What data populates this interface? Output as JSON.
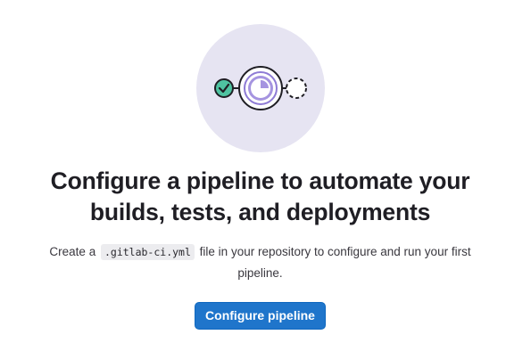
{
  "empty_state": {
    "illustration_icons": [
      "check-circle-icon",
      "pipeline-running-icon",
      "pending-dashed-circle-icon"
    ],
    "title_line1": "Configure a pipeline to automate your",
    "title_line2": "builds, tests, and deployments",
    "description_prefix": "Create a",
    "description_code": ".gitlab-ci.yml",
    "description_suffix": "file in your repository to configure and run your first",
    "description_line2": "pipeline.",
    "button_label": "Configure pipeline"
  },
  "colors": {
    "illustration_bg": "#e6e4f2",
    "success_green": "#2da160",
    "running_purple": "#8e7bd5",
    "primary_button": "#1f75cb"
  }
}
